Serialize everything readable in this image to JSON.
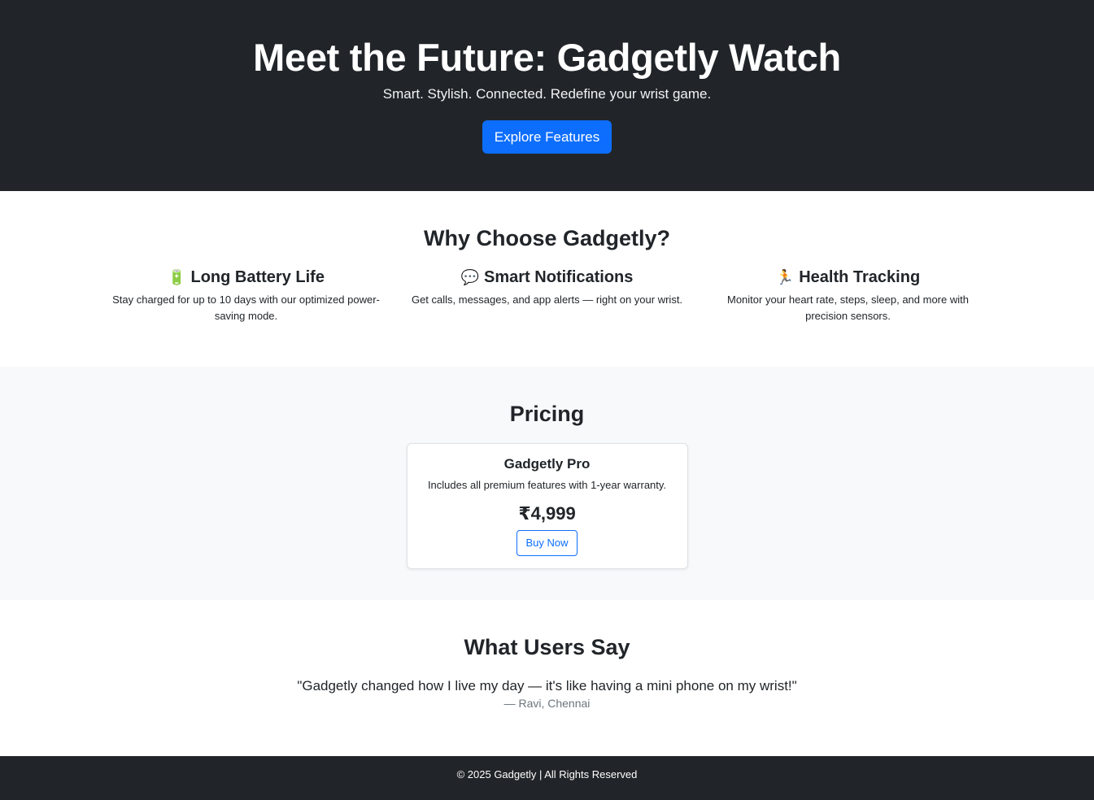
{
  "hero": {
    "title": "Meet the Future: Gadgetly Watch",
    "tagline": "Smart. Stylish. Connected. Redefine your wrist game.",
    "cta_label": "Explore Features",
    "background_color": "#212529",
    "cta_color": "#0d6efd"
  },
  "features": {
    "heading": "Why Choose Gadgetly?",
    "items": [
      {
        "icon": "battery-icon",
        "emoji": "🔋",
        "title": "Long Battery Life",
        "description": "Stay charged for up to 10 days with our optimized power-saving mode."
      },
      {
        "icon": "speech-bubble-icon",
        "emoji": "💬",
        "title": "Smart Notifications",
        "description": "Get calls, messages, and app alerts — right on your wrist."
      },
      {
        "icon": "runner-icon",
        "emoji": "🏃",
        "title": "Health Tracking",
        "description": "Monitor your heart rate, steps, sleep, and more with precision sensors."
      }
    ]
  },
  "pricing": {
    "heading": "Pricing",
    "plan": {
      "name": "Gadgetly Pro",
      "description": "Includes all premium features with 1-year warranty.",
      "price": "₹4,999",
      "button_label": "Buy Now"
    }
  },
  "testimonials": {
    "heading": "What Users Say",
    "quote": "\"Gadgetly changed how I live my day — it's like having a mini phone on my wrist!\"",
    "author": "— Ravi, Chennai"
  },
  "footer": {
    "text": "© 2025 Gadgetly | All Rights Reserved"
  }
}
